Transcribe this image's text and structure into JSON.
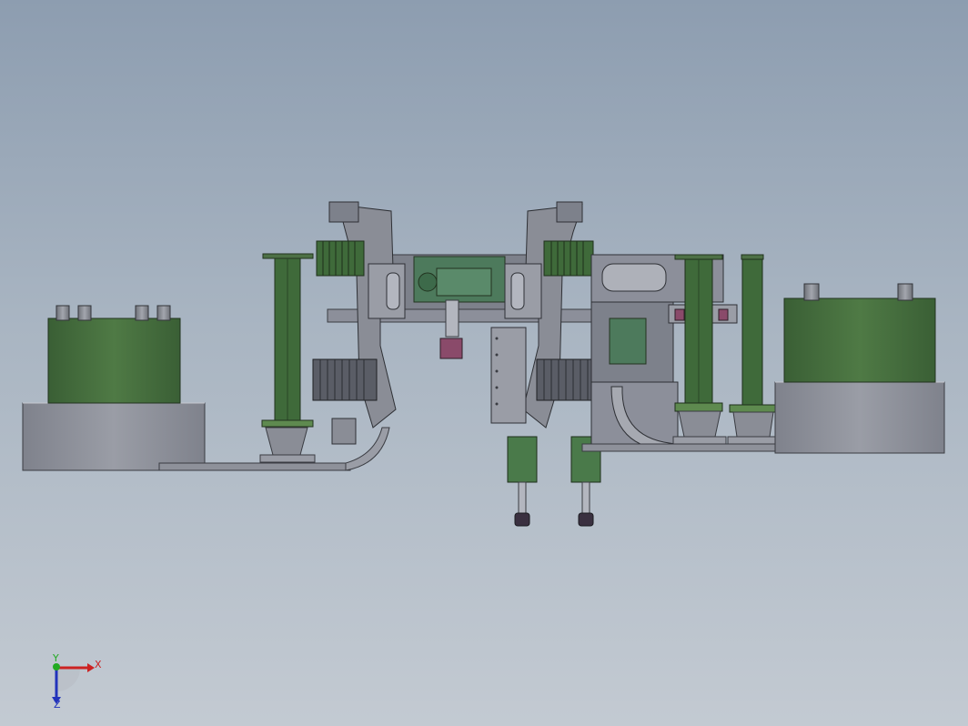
{
  "viewport": {
    "background_top": "#8d9db0",
    "background_bottom": "#c3cad2"
  },
  "colors": {
    "metal_gray": "#8c8f9a",
    "metal_dark": "#5d6068",
    "metal_light": "#b3b6bf",
    "green": "#3f6a3a",
    "green_light": "#5e8a4f",
    "green_dark": "#2f4f2c",
    "magenta": "#8a4a6a"
  },
  "triad": {
    "x_label": "X",
    "y_label": "Y",
    "z_label": "Z",
    "x_color": "#cc2222",
    "y_color": "#22aa22",
    "z_color": "#2233bb"
  }
}
